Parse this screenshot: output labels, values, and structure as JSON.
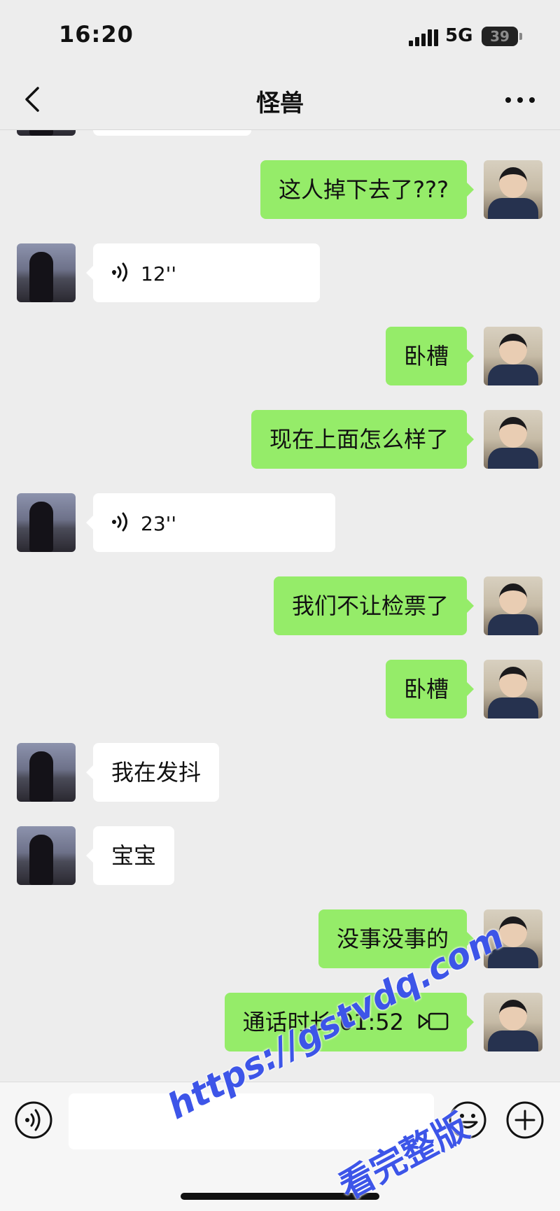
{
  "status_bar": {
    "time": "16:20",
    "network": "5G",
    "battery": "39",
    "signal_icon": "signal-bars-icon"
  },
  "nav": {
    "title": "怪兽",
    "back_icon": "chevron-left-icon",
    "more_icon": "more-dots-icon"
  },
  "messages": [
    {
      "sender": "me",
      "type": "text",
      "text": "这人掉下去了???"
    },
    {
      "sender": "other",
      "type": "voice",
      "duration": "12''"
    },
    {
      "sender": "me",
      "type": "text",
      "text": "卧槽"
    },
    {
      "sender": "me",
      "type": "text",
      "text": "现在上面怎么样了"
    },
    {
      "sender": "other",
      "type": "voice",
      "duration": "23''"
    },
    {
      "sender": "me",
      "type": "text",
      "text": "我们不让检票了"
    },
    {
      "sender": "me",
      "type": "text",
      "text": "卧槽"
    },
    {
      "sender": "other",
      "type": "text",
      "text": "我在发抖"
    },
    {
      "sender": "other",
      "type": "text",
      "text": "宝宝"
    },
    {
      "sender": "me",
      "type": "text",
      "text": "没事没事的"
    },
    {
      "sender": "me",
      "type": "call",
      "text": "通话时长 01:52"
    }
  ],
  "input_bar": {
    "placeholder": "",
    "voice_icon": "voice-input-icon",
    "emoji_icon": "emoji-icon",
    "plus_icon": "plus-icon"
  },
  "watermark": {
    "url": "https://gstvdq.com",
    "text": "看完整版"
  },
  "colors": {
    "background": "#ededed",
    "my_bubble": "#95ec69",
    "other_bubble": "#ffffff",
    "watermark": "#3d55e8"
  }
}
